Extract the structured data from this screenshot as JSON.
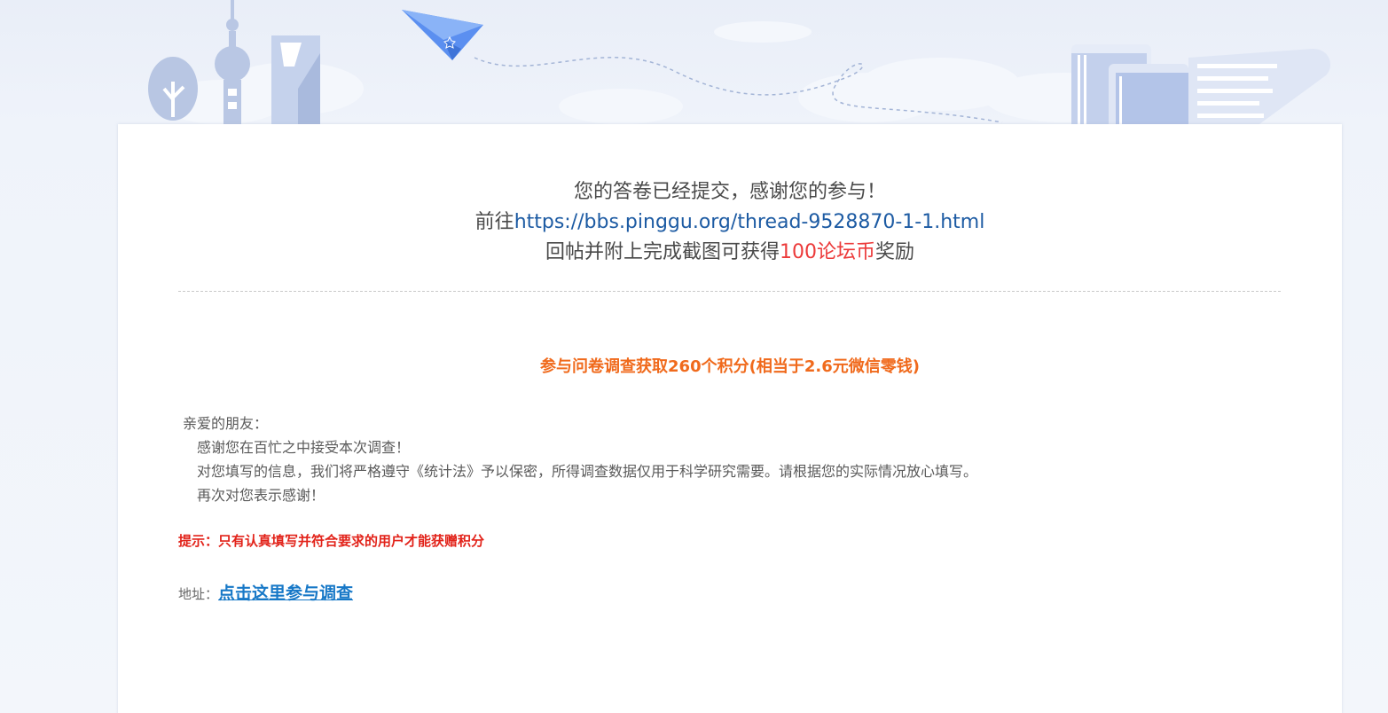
{
  "confirmation": {
    "line1": "您的答卷已经提交，感谢您的参与！",
    "line2_prefix": "前往",
    "line2_link": "https://bbs.pinggu.org/thread-9528870-1-1.html",
    "line3_prefix": "回帖并附上完成截图可获得",
    "line3_highlight": "100论坛币",
    "line3_suffix": "奖励"
  },
  "promo": {
    "title": "参与问卷调查获取260个积分(相当于2.6元微信零钱)"
  },
  "letter": {
    "greeting": "亲爱的朋友：",
    "para1": "感谢您在百忙之中接受本次调查！",
    "para2": "对您填写的信息，我们将严格遵守《统计法》予以保密，所得调查数据仅用于科学研究需要。请根据您的实际情况放心填写。",
    "para3": "再次对您表示感谢！"
  },
  "tip": {
    "text": "提示：只有认真填写并符合要求的用户才能获赠积分"
  },
  "address": {
    "label": "地址：",
    "link_text": "点击这里参与调查"
  },
  "colors": {
    "accent_orange": "#f06a1c",
    "accent_red": "#e2231a",
    "link_blue": "#1d5ba3",
    "highlight_red": "#ec3a3a"
  }
}
